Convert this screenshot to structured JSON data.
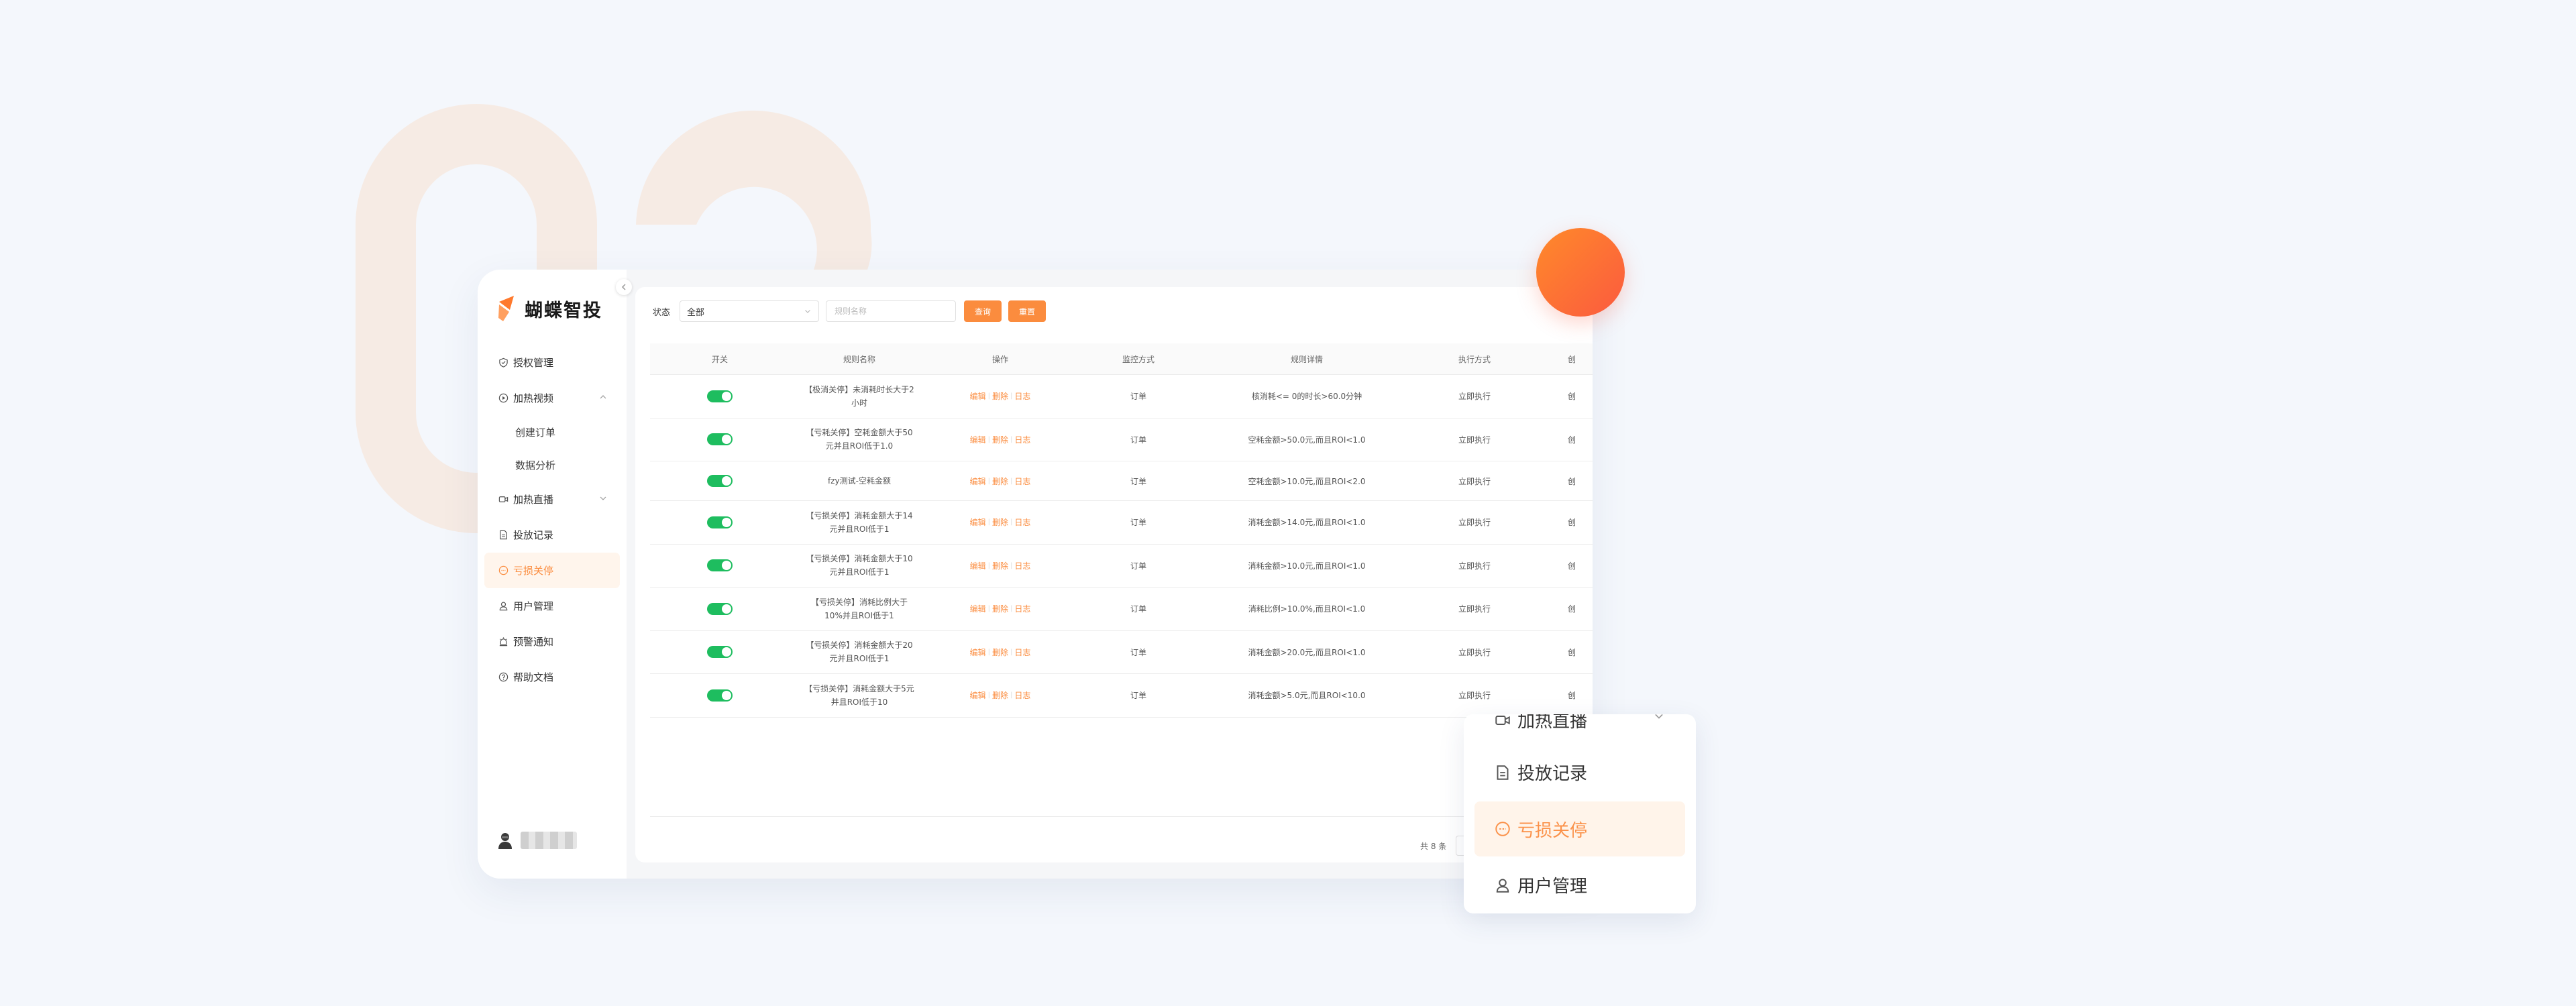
{
  "brand": {
    "name": "蝴蝶智投"
  },
  "sidebar": {
    "items": [
      {
        "label": "授权管理"
      },
      {
        "label": "加热视频"
      },
      {
        "label": "创建订单"
      },
      {
        "label": "数据分析"
      },
      {
        "label": "加热直播"
      },
      {
        "label": "投放记录"
      },
      {
        "label": "亏损关停"
      },
      {
        "label": "用户管理"
      },
      {
        "label": "预警通知"
      },
      {
        "label": "帮助文档"
      }
    ]
  },
  "filter": {
    "status_label": "状态",
    "status_value": "全部",
    "rule_placeholder": "规则名称",
    "search_label": "查询",
    "reset_label": "重置"
  },
  "table": {
    "headers": [
      "开关",
      "规则名称",
      "操作",
      "监控方式",
      "规则详情",
      "执行方式",
      "创"
    ],
    "rows": [
      {
        "name": "【极消关停】未消耗时长大于2小时",
        "op_edit": "编辑",
        "op_delete": "删除",
        "op_log": "日志",
        "monitor": "订单",
        "detail": "核消耗<= 0的时长>60.0分钟",
        "exec": "立即执行",
        "extra": "创"
      },
      {
        "name": "【亏耗关停】空耗金额大于50元并且ROI低于1.0",
        "op_edit": "编辑",
        "op_delete": "删除",
        "op_log": "日志",
        "monitor": "订单",
        "detail": "空耗金额>50.0元,而且ROI<1.0",
        "exec": "立即执行",
        "extra": "创"
      },
      {
        "name": "fzy测试-空耗金额",
        "op_edit": "编辑",
        "op_delete": "删除",
        "op_log": "日志",
        "monitor": "订单",
        "detail": "空耗金额>10.0元,而且ROI<2.0",
        "exec": "立即执行",
        "extra": "创"
      },
      {
        "name": "【亏损关停】消耗金额大于14元并且ROI低于1",
        "op_edit": "编辑",
        "op_delete": "删除",
        "op_log": "日志",
        "monitor": "订单",
        "detail": "消耗金额>14.0元,而且ROI<1.0",
        "exec": "立即执行",
        "extra": "创"
      },
      {
        "name": "【亏损关停】消耗金额大于10元并且ROI低于1",
        "op_edit": "编辑",
        "op_delete": "删除",
        "op_log": "日志",
        "monitor": "订单",
        "detail": "消耗金额>10.0元,而且ROI<1.0",
        "exec": "立即执行",
        "extra": "创"
      },
      {
        "name": "【亏损关停】消耗比例大于10%并且ROI低于1",
        "op_edit": "编辑",
        "op_delete": "删除",
        "op_log": "日志",
        "monitor": "订单",
        "detail": "消耗比例>10.0%,而且ROI<1.0",
        "exec": "立即执行",
        "extra": "创"
      },
      {
        "name": "【亏损关停】消耗金额大于20元并且ROI低于1",
        "op_edit": "编辑",
        "op_delete": "删除",
        "op_log": "日志",
        "monitor": "订单",
        "detail": "消耗金额>20.0元,而且ROI<1.0",
        "exec": "立即执行",
        "extra": "创"
      },
      {
        "name": "【亏损关停】消耗金额大于5元并且ROI低于10",
        "op_edit": "编辑",
        "op_delete": "删除",
        "op_log": "日志",
        "monitor": "订单",
        "detail": "消耗金额>5.0元,而且ROI<10.0",
        "exec": "立即执行",
        "extra": "创"
      }
    ]
  },
  "pager": {
    "total": "共 8 条"
  },
  "zoom": {
    "items": [
      {
        "label": "加热直播"
      },
      {
        "label": "投放记录"
      },
      {
        "label": "亏损关停"
      },
      {
        "label": "用户管理"
      }
    ]
  },
  "colors": {
    "accent": "#fb8c3e",
    "toggle_on": "#1ebd5f",
    "orb": "#fb5a3f",
    "numeral": "#f6ebe4"
  }
}
